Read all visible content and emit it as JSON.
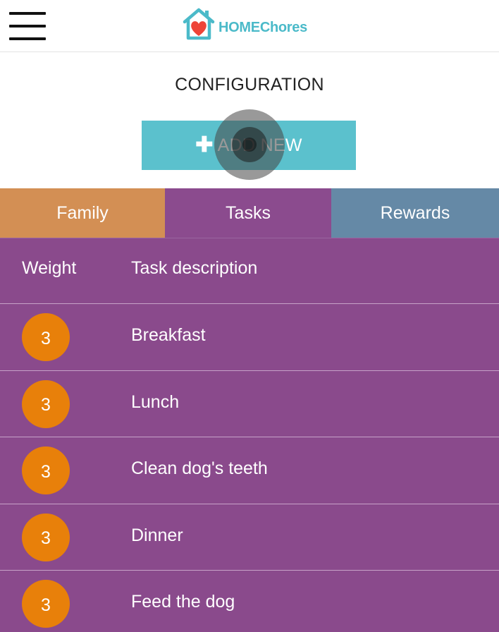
{
  "header": {
    "logo": {
      "home": "HOME",
      "chores": "Chores"
    }
  },
  "page": {
    "title": "CONFIGURATION",
    "add_button": {
      "icon": "plus-icon",
      "label": "ADD NEW"
    }
  },
  "tabs": [
    {
      "label": "Family",
      "color": "#d38f54"
    },
    {
      "label": "Tasks",
      "color": "#8b4b8e",
      "active": true
    },
    {
      "label": "Rewards",
      "color": "#6589a6"
    }
  ],
  "table": {
    "headers": {
      "weight": "Weight",
      "description": "Task description"
    },
    "rows": [
      {
        "weight": "3",
        "description": "Breakfast"
      },
      {
        "weight": "3",
        "description": "Lunch"
      },
      {
        "weight": "3",
        "description": "Clean dog's teeth"
      },
      {
        "weight": "3",
        "description": "Dinner"
      },
      {
        "weight": "3",
        "description": "Feed the dog"
      }
    ]
  },
  "colors": {
    "accent": "#5bc1cd",
    "badge": "#e8800a",
    "table_bg": "#8a4a8c"
  }
}
